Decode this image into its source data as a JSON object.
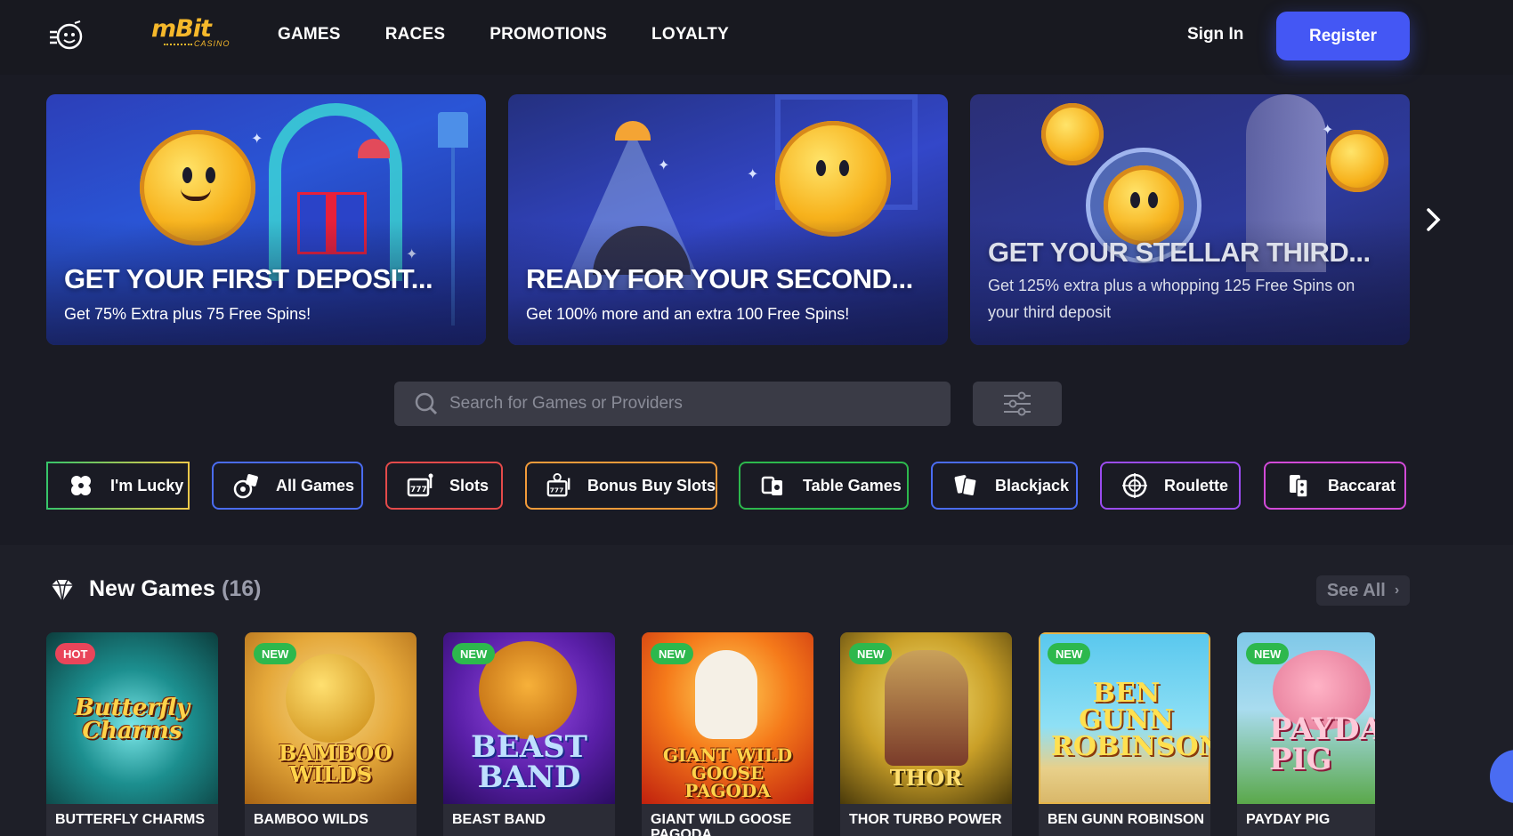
{
  "header": {
    "nav": [
      "GAMES",
      "RACES",
      "PROMOTIONS",
      "LOYALTY"
    ],
    "logo_text": "mBit",
    "logo_sub": "CASINO",
    "signin_label": "Sign In",
    "register_label": "Register",
    "accent_color": "#4457f4"
  },
  "banners": [
    {
      "title": "GET YOUR FIRST DEPOSIT...",
      "desc": "Get 75% Extra plus 75 Free Spins!"
    },
    {
      "title": "READY FOR YOUR SECOND...",
      "desc": "Get 100% more and an extra 100 Free Spins!"
    },
    {
      "title": "GET YOUR STELLAR THIRD...",
      "desc": "Get 125% extra plus a whopping 125 Free Spins on your third deposit"
    }
  ],
  "search": {
    "placeholder": "Search for Games or Providers"
  },
  "categories": [
    {
      "label": "I'm Lucky",
      "icon": "clover-icon"
    },
    {
      "label": "All Games",
      "icon": "dice-icon"
    },
    {
      "label": "Slots",
      "icon": "slot-machine-icon"
    },
    {
      "label": "Bonus Buy Slots",
      "icon": "bonus-slot-icon"
    },
    {
      "label": "Table Games",
      "icon": "table-games-icon"
    },
    {
      "label": "Blackjack",
      "icon": "cards-icon"
    },
    {
      "label": "Roulette",
      "icon": "roulette-icon"
    },
    {
      "label": "Baccarat",
      "icon": "baccarat-icon"
    }
  ],
  "new_games": {
    "title": "New Games",
    "count": "(16)",
    "see_all_label": "See All",
    "games": [
      {
        "name": "BUTTERFLY CHARMS",
        "badge": "HOT",
        "art": "Butterfly Charms"
      },
      {
        "name": "BAMBOO WILDS",
        "badge": "NEW",
        "art": "BAMBOO WILDS"
      },
      {
        "name": "BEAST BAND",
        "badge": "NEW",
        "art": "BEAST BAND"
      },
      {
        "name": "GIANT WILD GOOSE PAGODA",
        "badge": "NEW",
        "art": "GIANT WILD GOOSE PAGODA"
      },
      {
        "name": "THOR TURBO POWER",
        "badge": "NEW",
        "art": "THOR"
      },
      {
        "name": "BEN GUNN ROBINSON",
        "badge": "NEW",
        "art": "BEN GUNN ROBINSON"
      },
      {
        "name": "PAYDAY PIG",
        "badge": "NEW",
        "art": "PAYDAY PIG"
      }
    ]
  }
}
